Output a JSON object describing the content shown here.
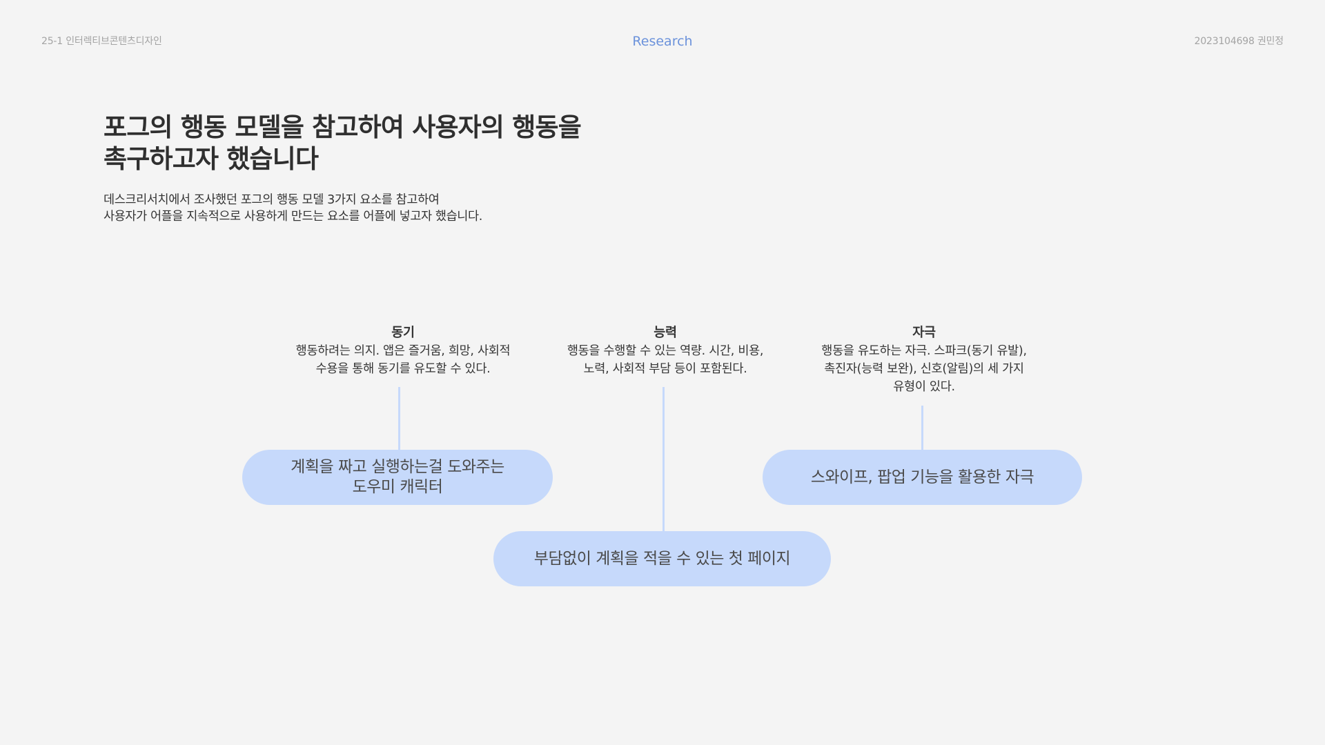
{
  "header": {
    "course": "25-1 인터렉티브콘텐츠디자인",
    "section": "Research",
    "student": "2023104698 권민정"
  },
  "title": {
    "line1": "포그의 행동 모델을 참고하여 사용자의 행동을",
    "line2": "촉구하고자 했습니다"
  },
  "description": {
    "line1": "데스크리서치에서 조사했던 포그의 행동 모델 3가지 요소를 참고하여",
    "line2": "사용자가 어플을 지속적으로 사용하게 만드는 요소를 어플에 넣고자 했습니다."
  },
  "concepts": [
    {
      "title": "동기",
      "desc": [
        "행동하려는 의지. 앱은 즐거움, 희망, 사회적",
        "수용을 통해 동기를 유도할 수 있다."
      ]
    },
    {
      "title": "능력",
      "desc": [
        "행동을 수행할 수 있는 역량. 시간, 비용,",
        "노력, 사회적 부담 등이 포함된다."
      ]
    },
    {
      "title": "자극",
      "desc": [
        "행동을 유도하는 자극. 스파크(동기 유발),",
        "촉진자(능력 보완), 신호(알림)의 세 가지",
        "유형이 있다."
      ]
    }
  ],
  "features": [
    {
      "lines": [
        "계획을 짜고 실행하는걸 도와주는",
        "도우미 캐릭터"
      ]
    },
    {
      "lines": [
        "부담없이 계획을 적을 수 있는 첫 페이지"
      ]
    },
    {
      "lines": [
        "스와이프, 팝업 기능을 활용한 자극"
      ]
    }
  ],
  "colors": {
    "background": "#f4f4f4",
    "accent": "#6b92db",
    "pill": "#c6d9fb"
  }
}
